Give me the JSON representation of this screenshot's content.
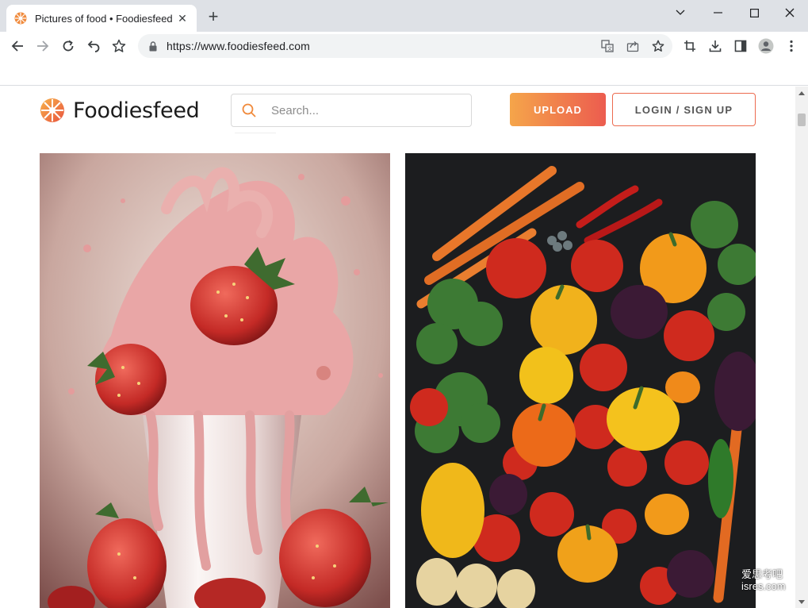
{
  "browser": {
    "tab_title": "Pictures of food • Foodiesfeed",
    "url": "https://www.foodiesfeed.com",
    "new_tab_icon": "plus-icon",
    "window_controls": [
      "chevron-down-icon",
      "minimize-icon",
      "maximize-icon",
      "close-icon"
    ]
  },
  "site": {
    "logo_text": "Foodiesfeed",
    "search_placeholder": "Search...",
    "upload_label": "UPLOAD",
    "login_label": "LOGIN / SIGN UP",
    "brand_colors": {
      "orange": "#f5a54a",
      "red": "#ec5c4f"
    }
  },
  "gallery": {
    "photos": [
      {
        "subject": "strawberry milkshake splash"
      },
      {
        "subject": "colorful vegetables"
      }
    ]
  },
  "overlay": {
    "watermark_line1": "爱思考吧",
    "watermark_line2": "isres.com"
  }
}
